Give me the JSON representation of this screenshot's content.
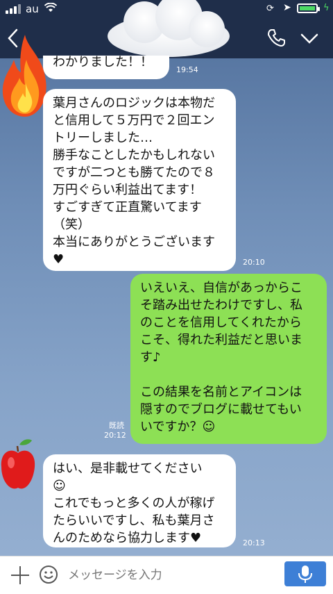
{
  "status_bar": {
    "carrier": "au"
  },
  "messages": [
    {
      "side": "left",
      "lines": [
        "わかりました！！"
      ],
      "time": "19:54"
    },
    {
      "side": "left",
      "lines": [
        "葉月さんのロジックは本物だ",
        "と信用して５万円で２回エン",
        "トリーしました…",
        "勝手なことしたかもしれない",
        "ですが二つとも勝てたので８",
        "万円ぐらい利益出てます！",
        "すごすぎて正直驚いてます",
        "（笑）",
        "本当にありがとうございます",
        "♥"
      ],
      "time": "20:10"
    },
    {
      "side": "right",
      "lines": [
        "いえいえ、自信があっからこ",
        "そ踏み出せたわけですし、私",
        "のことを信用してくれたから",
        "こそ、得れた利益だと思いま",
        "す♪",
        "",
        "この結果を名前とアイコンは",
        "隠すのでブログに載せてもい",
        "いですか？☺"
      ],
      "read": "既読",
      "time": "20:12"
    },
    {
      "side": "left",
      "lines": [
        "はい、是非載せてください",
        "☺",
        "これでもっと多くの人が稼げ",
        "たらいいですし、私も葉月さ",
        "んのためなら協力します♥"
      ],
      "time": "20:13"
    }
  ],
  "input": {
    "placeholder": "メッセージを入力"
  },
  "colors": {
    "header_bg": "#1f2e4a",
    "bubble_left": "#ffffff",
    "bubble_right": "#8de055",
    "mic_button": "#3d7fd6",
    "battery": "#4cd964"
  },
  "battery_level": 0.85
}
